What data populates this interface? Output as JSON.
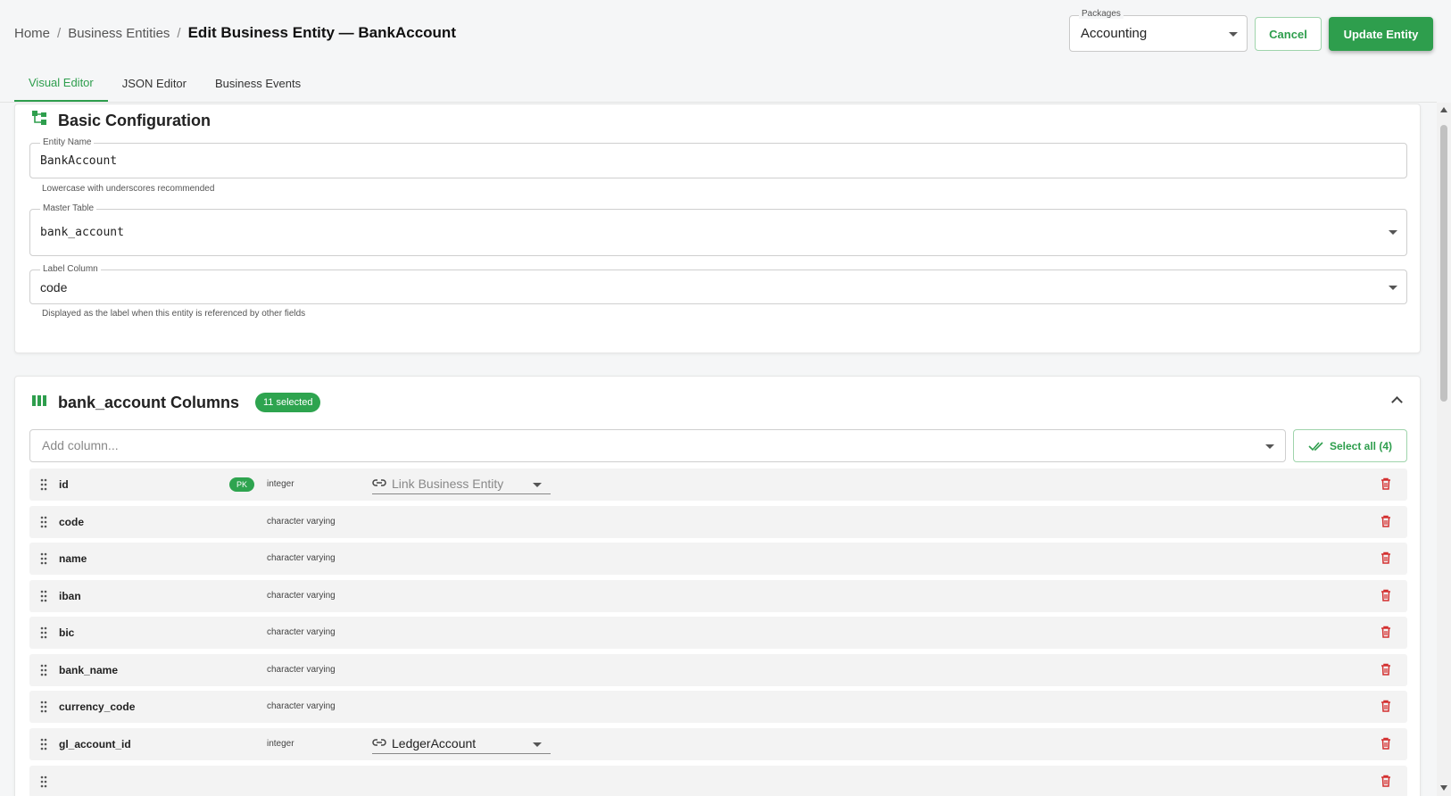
{
  "breadcrumb": {
    "home": "Home",
    "entities": "Business Entities",
    "current": "Edit Business Entity — BankAccount"
  },
  "packages": {
    "label": "Packages",
    "value": "Accounting"
  },
  "actions": {
    "cancel": "Cancel",
    "update": "Update Entity"
  },
  "tabs": [
    {
      "label": "Visual Editor",
      "active": true
    },
    {
      "label": "JSON Editor",
      "active": false
    },
    {
      "label": "Business Events",
      "active": false
    }
  ],
  "basic": {
    "title": "Basic Configuration",
    "entity_name": {
      "label": "Entity Name",
      "value": "BankAccount",
      "hint": "Lowercase with underscores recommended"
    },
    "master_table": {
      "label": "Master Table",
      "value": "bank_account"
    },
    "label_column": {
      "label": "Label Column",
      "value": "code",
      "hint": "Displayed as the label when this entity is referenced by other fields"
    }
  },
  "columns": {
    "title": "bank_account Columns",
    "selected_badge": "11 selected",
    "add_placeholder": "Add column...",
    "select_all": "Select all (4)",
    "rows": [
      {
        "name": "id",
        "pk": "PK",
        "type": "integer",
        "link": "Link Business Entity",
        "link_placeholder": true
      },
      {
        "name": "code",
        "type": "character varying"
      },
      {
        "name": "name",
        "type": "character varying"
      },
      {
        "name": "iban",
        "type": "character varying"
      },
      {
        "name": "bic",
        "type": "character varying"
      },
      {
        "name": "bank_name",
        "type": "character varying"
      },
      {
        "name": "currency_code",
        "type": "character varying"
      },
      {
        "name": "gl_account_id",
        "type": "integer",
        "link": "LedgerAccount",
        "link_placeholder": false
      }
    ]
  },
  "colors": {
    "accent": "#2e9e4d",
    "danger": "#d32f2f"
  }
}
